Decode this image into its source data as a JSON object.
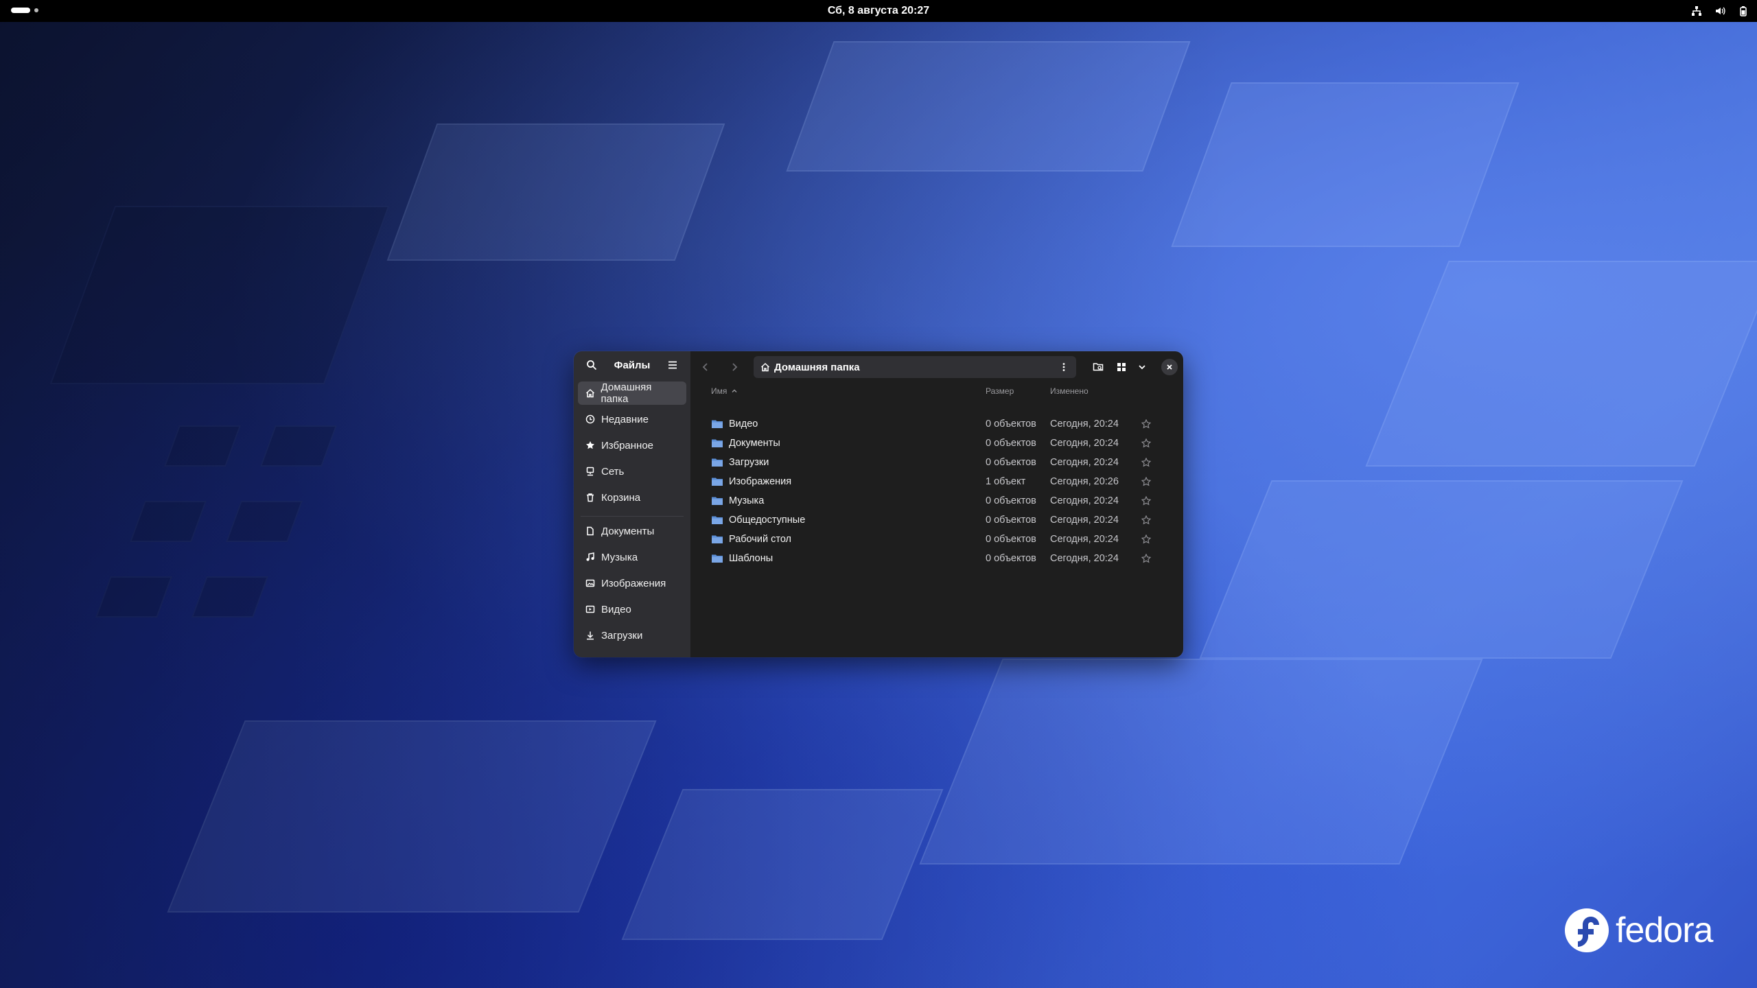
{
  "topbar": {
    "clock": "Сб, 8 августа  20:27",
    "tray_icons": [
      "network-icon",
      "volume-icon",
      "battery-icon"
    ]
  },
  "window": {
    "app_title": "Файлы",
    "location": "Домашняя папка",
    "sidebar": {
      "places": [
        {
          "label": "Домашняя папка",
          "icon": "home-icon",
          "active": true
        },
        {
          "label": "Недавние",
          "icon": "clock-icon"
        },
        {
          "label": "Избранное",
          "icon": "star-icon"
        },
        {
          "label": "Сеть",
          "icon": "network-icon"
        },
        {
          "label": "Корзина",
          "icon": "trash-icon"
        }
      ],
      "bookmarks": [
        {
          "label": "Документы",
          "icon": "document-icon"
        },
        {
          "label": "Музыка",
          "icon": "music-icon"
        },
        {
          "label": "Изображения",
          "icon": "image-icon"
        },
        {
          "label": "Видео",
          "icon": "video-icon"
        },
        {
          "label": "Загрузки",
          "icon": "download-icon"
        }
      ]
    },
    "columns": {
      "name": "Имя",
      "size": "Размер",
      "modified": "Изменено"
    },
    "files": [
      {
        "name": "Видео",
        "size": "0 объектов",
        "modified": "Сегодня, 20:24"
      },
      {
        "name": "Документы",
        "size": "0 объектов",
        "modified": "Сегодня, 20:24"
      },
      {
        "name": "Загрузки",
        "size": "0 объектов",
        "modified": "Сегодня, 20:24"
      },
      {
        "name": "Изображения",
        "size": "1 объект",
        "modified": "Сегодня, 20:26"
      },
      {
        "name": "Музыка",
        "size": "0 объектов",
        "modified": "Сегодня, 20:24"
      },
      {
        "name": "Общедоступные",
        "size": "0 объектов",
        "modified": "Сегодня, 20:24"
      },
      {
        "name": "Рабочий стол",
        "size": "0 объектов",
        "modified": "Сегодня, 20:24"
      },
      {
        "name": "Шаблоны",
        "size": "0 объектов",
        "modified": "Сегодня, 20:24"
      }
    ]
  },
  "desktop": {
    "logo_text": "fedora"
  },
  "colors": {
    "accent_folder": "#5b8ed6",
    "window_bg": "#1e1e1e",
    "sidebar_bg": "#2e2e32"
  }
}
